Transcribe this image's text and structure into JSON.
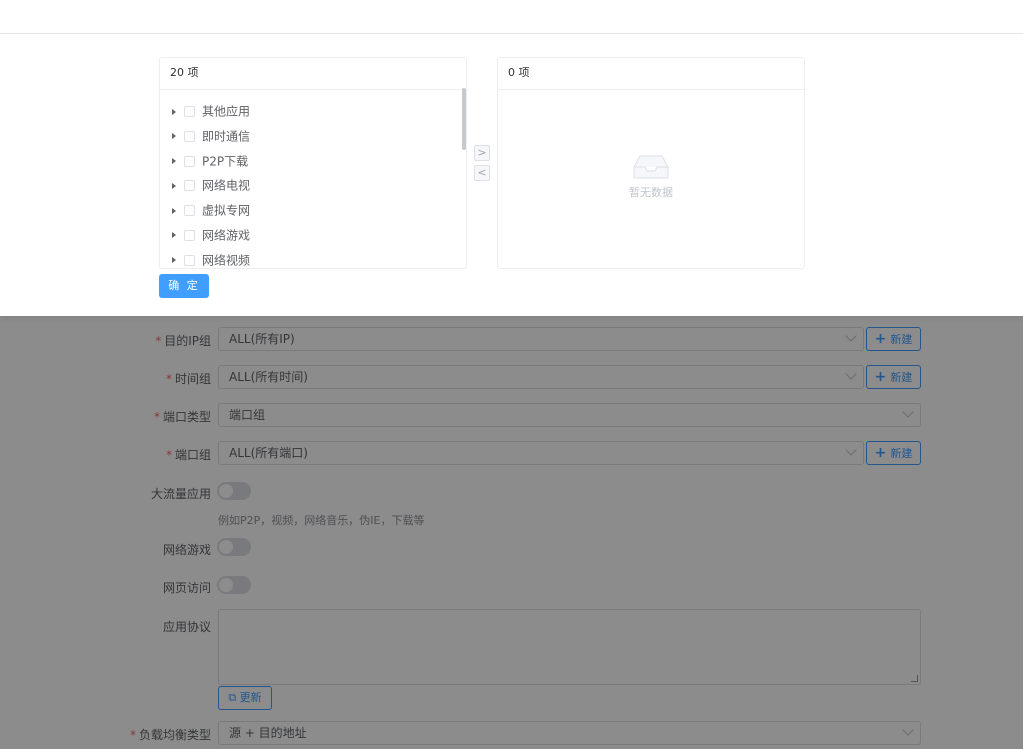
{
  "transfer": {
    "left_count": "20 项",
    "right_count": "0 项",
    "items": [
      "其他应用",
      "即时通信",
      "P2P下载",
      "网络电视",
      "虚拟专网",
      "网络游戏",
      "网络视频"
    ],
    "to_right": ">",
    "to_left": "<",
    "empty_text": "暂无数据",
    "confirm_label": "确 定"
  },
  "form": {
    "dest_ip_group": {
      "label": "目的IP组",
      "value": "ALL(所有IP)",
      "new_label": "新建"
    },
    "time_group": {
      "label": "时间组",
      "value": "ALL(所有时间)",
      "new_label": "新建"
    },
    "port_type": {
      "label": "端口类型",
      "value": "端口组"
    },
    "port_group": {
      "label": "端口组",
      "value": "ALL(所有端口)",
      "new_label": "新建"
    },
    "heavy_traffic": {
      "label": "大流量应用",
      "hint": "例如P2P，视频，网络音乐，伪IE，下载等"
    },
    "online_game": {
      "label": "网络游戏"
    },
    "web_access": {
      "label": "网页访问"
    },
    "app_protocol": {
      "label": "应用协议",
      "update_label": "更新"
    },
    "load_balance": {
      "label": "负载均衡类型",
      "value": "源 + 目的地址"
    },
    "required_mark": "*"
  },
  "colors": {
    "primary": "#409eff",
    "required": "#f56c6c",
    "overlay": "rgba(0,0,0,0.45)"
  }
}
